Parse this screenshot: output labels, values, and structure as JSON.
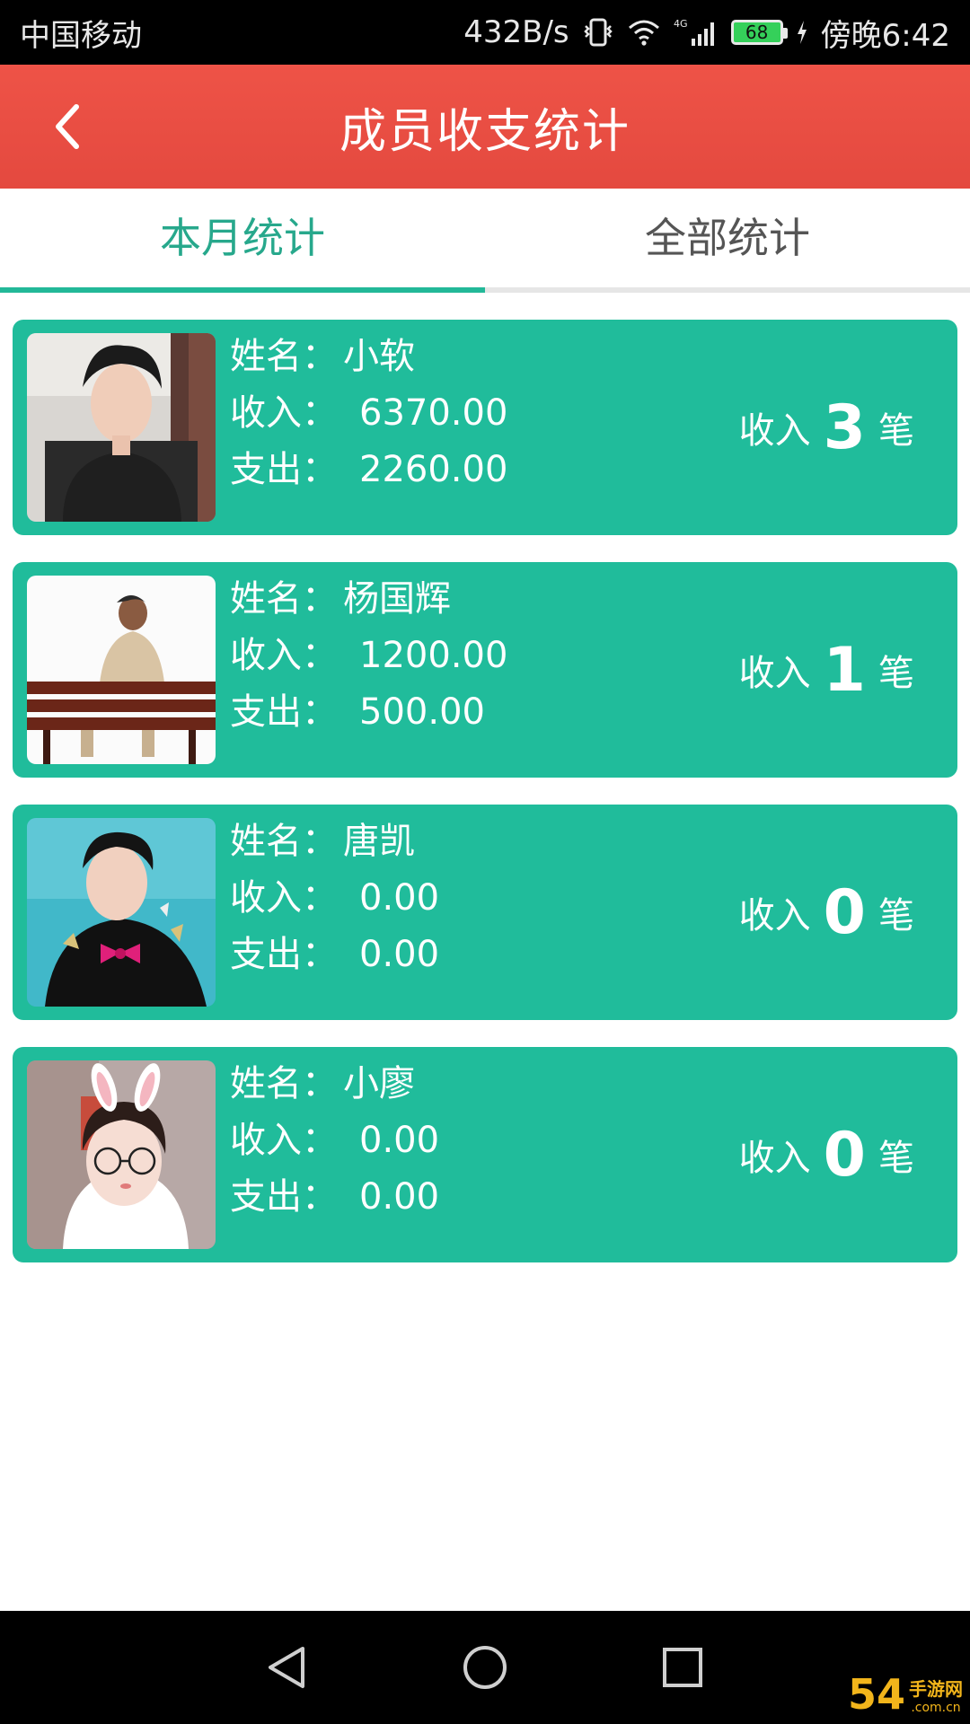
{
  "status_bar": {
    "carrier": "中国移动",
    "speed": "432B/s",
    "network": "4G",
    "battery": "68",
    "time": "傍晚6:42",
    "icons": [
      "vibrate-icon",
      "wifi-icon",
      "signal-icon",
      "battery-icon",
      "charging-icon"
    ]
  },
  "header": {
    "title": "成员收支统计",
    "back_icon": "chevron-left-icon",
    "color": "#e94c41"
  },
  "tabs": [
    {
      "label": "本月统计",
      "active": true
    },
    {
      "label": "全部统计",
      "active": false
    }
  ],
  "accent_color": "#20bc9b",
  "labels": {
    "name": "姓名：",
    "income": "收入：",
    "expense": "支出：",
    "count_prefix": "收入",
    "count_suffix": "笔"
  },
  "members": [
    {
      "name": "小软",
      "income": "6370.00",
      "expense": "2260.00",
      "count": "3"
    },
    {
      "name": "杨国辉",
      "income": "1200.00",
      "expense": "500.00",
      "count": "1"
    },
    {
      "name": "唐凯",
      "income": "0.00",
      "expense": "0.00",
      "count": "0"
    },
    {
      "name": "小廖",
      "income": "0.00",
      "expense": "0.00",
      "count": "0"
    }
  ],
  "nav_bar": {
    "icons": [
      "back-triangle-icon",
      "home-circle-icon",
      "recents-square-icon"
    ]
  },
  "watermark": {
    "brand": "54",
    "line1": "手游网",
    "line2": ".com.cn"
  }
}
